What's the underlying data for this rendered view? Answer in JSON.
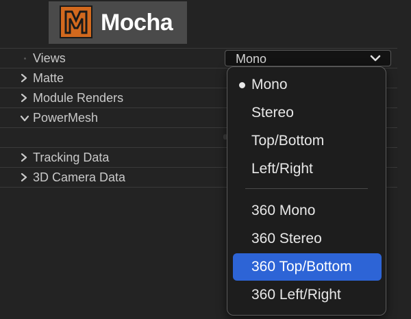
{
  "logo": {
    "text": "Mocha"
  },
  "properties": {
    "rows": [
      {
        "label": "Views",
        "expander": "none"
      },
      {
        "label": "Matte",
        "expander": "collapsed"
      },
      {
        "label": "Module Renders",
        "expander": "collapsed"
      },
      {
        "label": "PowerMesh",
        "expander": "expanded"
      },
      {
        "label": "",
        "expander": "none"
      },
      {
        "label": "Tracking Data",
        "expander": "collapsed"
      },
      {
        "label": "3D Camera Data",
        "expander": "collapsed"
      }
    ]
  },
  "views_select": {
    "value": "Mono",
    "icon": "chevron-down-icon"
  },
  "dropdown": {
    "items": [
      {
        "label": "Mono",
        "checked": true,
        "highlighted": false
      },
      {
        "label": "Stereo",
        "checked": false,
        "highlighted": false
      },
      {
        "label": "Top/Bottom",
        "checked": false,
        "highlighted": false
      },
      {
        "label": "Left/Right",
        "checked": false,
        "highlighted": false
      },
      {
        "label": "360 Mono",
        "checked": false,
        "highlighted": false
      },
      {
        "label": "360 Stereo",
        "checked": false,
        "highlighted": false
      },
      {
        "label": "360 Top/Bottom",
        "checked": false,
        "highlighted": true
      },
      {
        "label": "360 Left/Right",
        "checked": false,
        "highlighted": false
      }
    ]
  },
  "colors": {
    "background": "#232323",
    "highlight": "#2d64d6",
    "logo_mark": "#d2691e",
    "logo_bg": "#4a4a4a"
  }
}
